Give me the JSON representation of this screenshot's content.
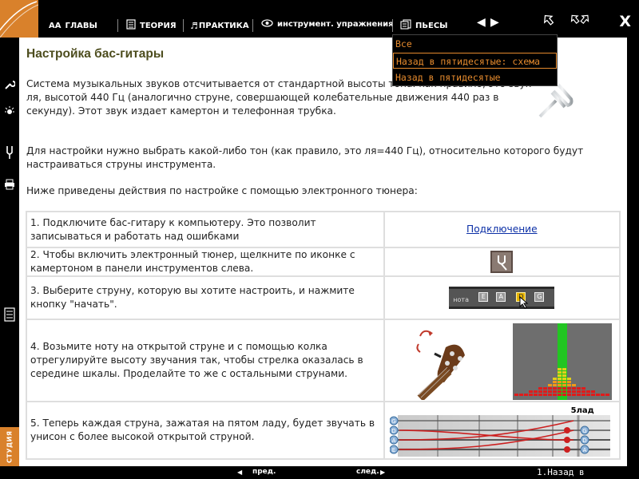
{
  "topbar": {
    "nav": [
      {
        "label": "ГЛАВЫ",
        "icon": "text-size-icon"
      },
      {
        "label": "ТЕОРИЯ",
        "icon": "book-icon"
      },
      {
        "label": "ПРАКТИКА",
        "icon": "music-note-icon"
      },
      {
        "label": "инструмент. упражнения",
        "icon": "eye-icon"
      },
      {
        "label": "ПЬЕСЫ",
        "icon": "sheets-icon"
      }
    ],
    "close": "X"
  },
  "dropdown": {
    "items": [
      "Все",
      "Назад в пятидесятые: схема",
      "Назад в пятидесятые"
    ],
    "selected_index": 1,
    "color": "#e58a2d"
  },
  "page": {
    "title": "Настройка бас-гитары",
    "p1": "Система музыкальных звуков отсчитывается от стандартной высоты тона: как правило, это звук ля, высотой 440 Гц (аналогично струне, совершающей колебательные движения 440 раз в секунду). Этот звук издает камертон и телефонная трубка.",
    "p2": "Для настройки нужно выбрать какой-либо тон (как правило, это ля=440 Гц), относительно которого будут настраиваться струны инструмента.",
    "p3": "Ниже приведены действия по настройке с помощью электронного тюнера:"
  },
  "steps": [
    {
      "text": "1. Подключите бас-гитару к компьютеру. Это позволит записываться и работать над ошибками",
      "link": "Подключение"
    },
    {
      "text": "2. Чтобы включить электронный тюнер, щелкните по иконке с камертоном в панели инструментов слева."
    },
    {
      "text": "3. Выберите струну, которую вы хотите настроить, и нажмите кнопку \"начать\".",
      "tuner": {
        "label": "нота",
        "keys": [
          "E",
          "A",
          "D",
          "G"
        ],
        "active_key": "D"
      }
    },
    {
      "text": "4. Возьмите ноту на открытой струне и с помощью колка отрегулируйте высоту звучания так, чтобы стрелка оказалась в середине шкалы. Проделайте то же с остальными струнами."
    },
    {
      "text": "5. Теперь каждая струна, зажатая на пятом ладу, будет звучать в унисон с более высокой открытой струной.",
      "fret_label": "5лад",
      "left_strings": [
        "G",
        "D",
        "A",
        "E"
      ],
      "right_strings": [
        "G",
        "D",
        "A"
      ]
    }
  ],
  "bottombar": {
    "prev": "пред.",
    "next": "след.",
    "right": "1.Назад в"
  },
  "leftrail": {
    "studio": "СТУДИЯ"
  },
  "colors": {
    "accent": "#d9812b",
    "title": "#4d4d1e",
    "link": "#0b2fa6"
  }
}
